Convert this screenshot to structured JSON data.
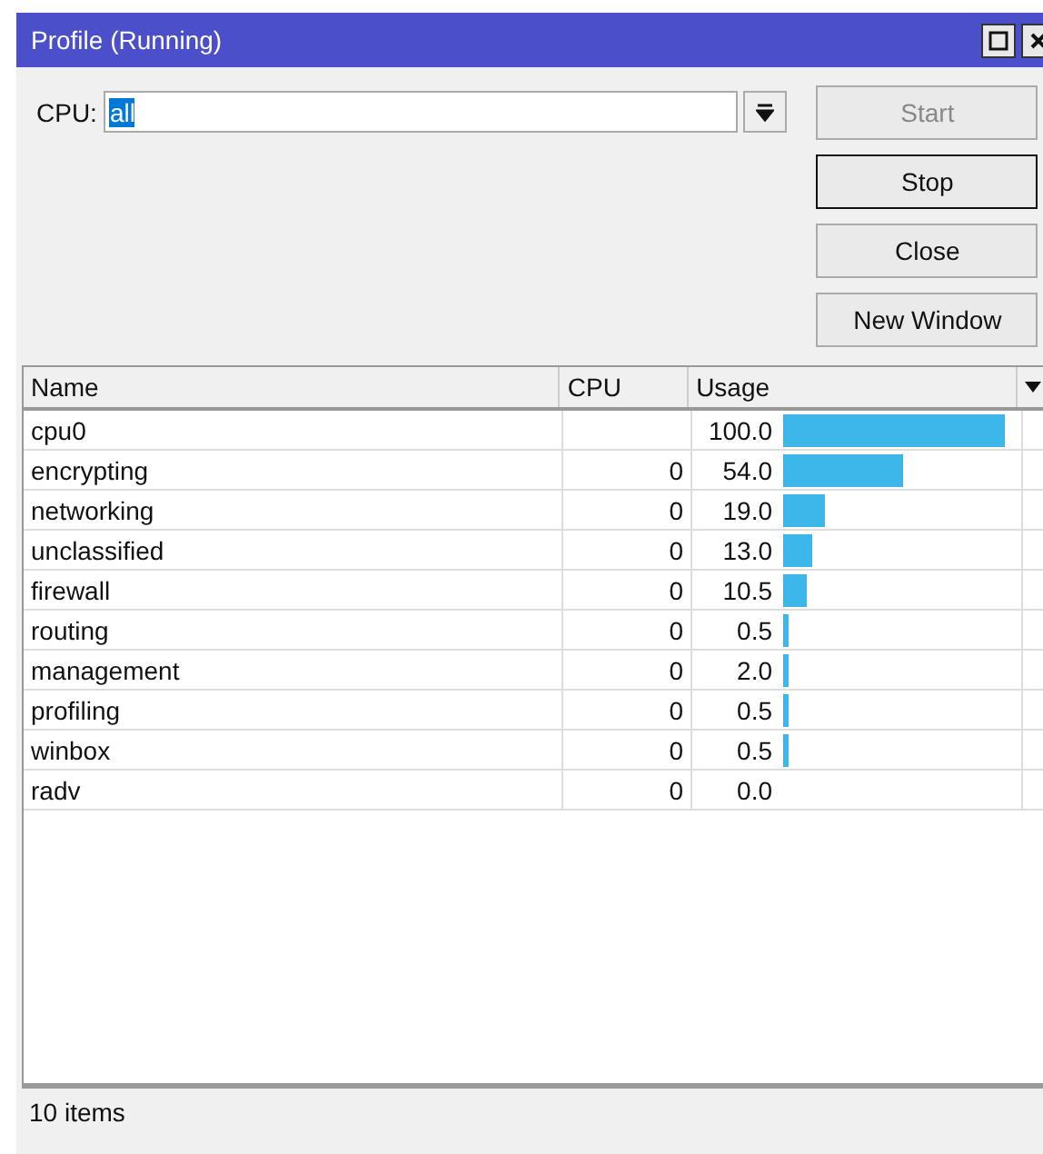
{
  "window": {
    "title": "Profile (Running)"
  },
  "cpu_field": {
    "label": "CPU:",
    "value": "all"
  },
  "buttons": [
    {
      "label": "Start",
      "disabled": true,
      "focused": false
    },
    {
      "label": "Stop",
      "disabled": false,
      "focused": true
    },
    {
      "label": "Close",
      "disabled": false,
      "focused": false
    },
    {
      "label": "New Window",
      "disabled": false,
      "focused": false
    }
  ],
  "table": {
    "columns": [
      "Name",
      "CPU",
      "Usage"
    ],
    "rows": [
      {
        "name": "cpu0",
        "cpu": "",
        "usage": "100.0"
      },
      {
        "name": "encrypting",
        "cpu": "0",
        "usage": "54.0"
      },
      {
        "name": "networking",
        "cpu": "0",
        "usage": "19.0"
      },
      {
        "name": "unclassified",
        "cpu": "0",
        "usage": "13.0"
      },
      {
        "name": "firewall",
        "cpu": "0",
        "usage": "10.5"
      },
      {
        "name": "routing",
        "cpu": "0",
        "usage": "0.5"
      },
      {
        "name": "management",
        "cpu": "0",
        "usage": "2.0"
      },
      {
        "name": "profiling",
        "cpu": "0",
        "usage": "0.5"
      },
      {
        "name": "winbox",
        "cpu": "0",
        "usage": "0.5"
      },
      {
        "name": "radv",
        "cpu": "0",
        "usage": "0.0"
      }
    ]
  },
  "status_bar": "10 items"
}
